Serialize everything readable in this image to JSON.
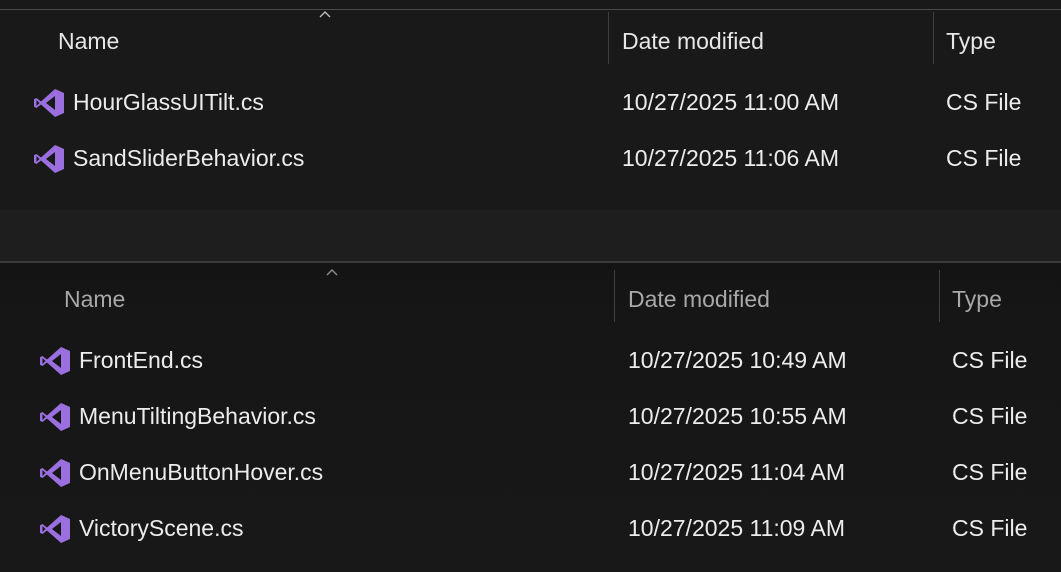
{
  "colors": {
    "background": "#191919",
    "text": "#ececec",
    "header_text_active": "#e6e6e6",
    "header_text_inactive": "#a8a8a8",
    "icon_purple": "#9b6fe0"
  },
  "top_pane": {
    "columns": {
      "name": "Name",
      "date_modified": "Date modified",
      "type": "Type"
    },
    "sort_icon": "chevron-up-icon",
    "files": [
      {
        "icon": "visual-studio-cs-file-icon",
        "name": "HourGlassUITilt.cs",
        "date_modified": "10/27/2025 11:00 AM",
        "type": "CS File"
      },
      {
        "icon": "visual-studio-cs-file-icon",
        "name": "SandSliderBehavior.cs",
        "date_modified": "10/27/2025 11:06 AM",
        "type": "CS File"
      }
    ]
  },
  "bottom_pane": {
    "columns": {
      "name": "Name",
      "date_modified": "Date modified",
      "type": "Type"
    },
    "sort_icon": "chevron-up-icon",
    "files": [
      {
        "icon": "visual-studio-cs-file-icon",
        "name": "FrontEnd.cs",
        "date_modified": "10/27/2025 10:49 AM",
        "type": "CS File"
      },
      {
        "icon": "visual-studio-cs-file-icon",
        "name": "MenuTiltingBehavior.cs",
        "date_modified": "10/27/2025 10:55 AM",
        "type": "CS File"
      },
      {
        "icon": "visual-studio-cs-file-icon",
        "name": "OnMenuButtonHover.cs",
        "date_modified": "10/27/2025 11:04 AM",
        "type": "CS File"
      },
      {
        "icon": "visual-studio-cs-file-icon",
        "name": "VictoryScene.cs",
        "date_modified": "10/27/2025 11:09 AM",
        "type": "CS File"
      }
    ]
  }
}
